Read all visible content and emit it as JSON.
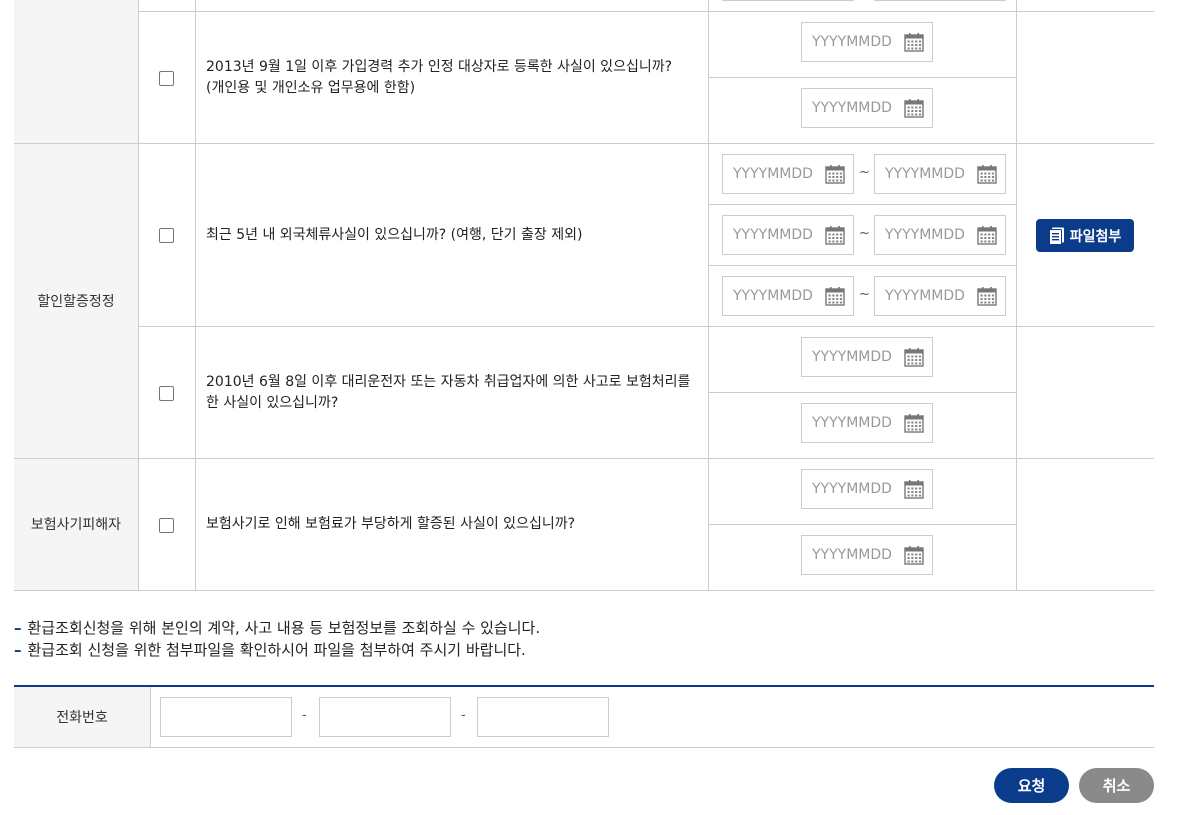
{
  "categories": {
    "discount_correction": "할인할증정정",
    "insurance_fraud_victim": "보험사기피해자"
  },
  "questions": {
    "q1": "2013년 9월 1일 이후 가입경력 추가 인정 대상자로 등록한 사실이 있으십니까?",
    "q1_sub": "(개인용 및 개인소유 업무용에 한함)",
    "q2": "최근 5년 내 외국체류사실이 있으십니까? (여행, 단기 출장 제외)",
    "q3": "2010년 6월 8일 이후 대리운전자 또는 자동차 취급업자에 의한 사고로 보험처리를 한 사실이 있으십니까?",
    "q4": "보험사기로 인해 보험료가 부당하게 할증된 사실이 있으십니까?"
  },
  "date_placeholder": "YYYYMMDD",
  "range_separator": "~",
  "file_attach_label": "파일첨부",
  "notes": [
    "환급조회신청을 위해 본인의 계약, 사고 내용 등 보험정보를 조회하실 수 있습니다.",
    "환급조회 신청을 위한 첨부파일을 확인하시어 파일을 첨부하여 주시기 바랍니다."
  ],
  "note_marker": "–",
  "phone": {
    "label": "전화번호",
    "separator": "-"
  },
  "buttons": {
    "request": "요청",
    "cancel": "취소"
  },
  "colors": {
    "primary": "#0b3c8c",
    "cancel": "#8a8a8a",
    "category_bg": "#f5f5f5",
    "border": "#cccccc"
  }
}
